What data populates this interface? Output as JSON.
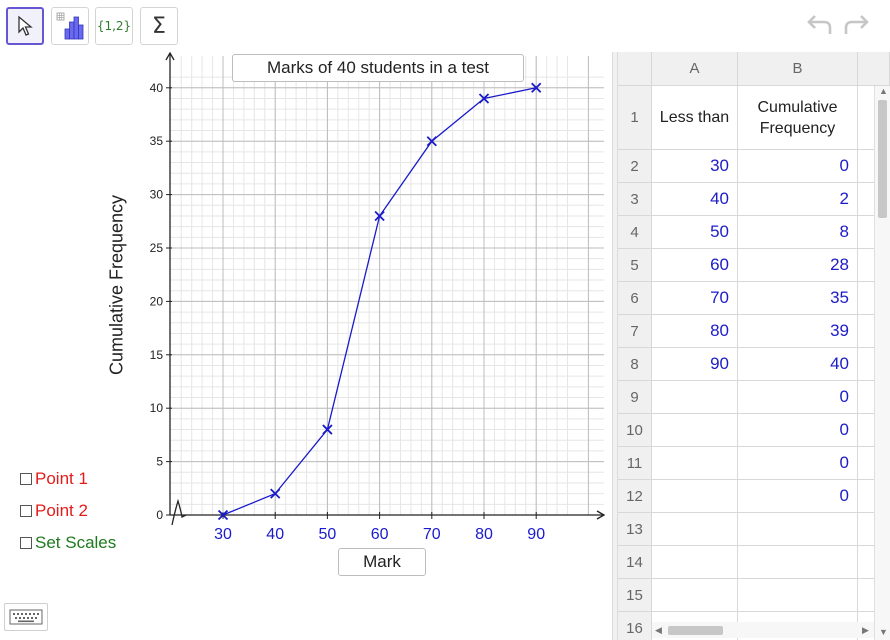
{
  "toolbar": {
    "tools": [
      {
        "name": "move-tool",
        "icon": "cursor-arrow-icon",
        "active": true
      },
      {
        "name": "histogram-tool",
        "icon": "bar-chart-icon",
        "active": false
      },
      {
        "name": "create-list-tool",
        "label": "{1,2}",
        "active": false
      },
      {
        "name": "sum-tool",
        "label": "Σ",
        "active": false
      }
    ],
    "undo_icon": "undo-arrow-icon",
    "redo_icon": "redo-arrow-icon"
  },
  "graph": {
    "title": "Marks of 40 students in a test",
    "xlabel": "Mark",
    "ylabel": "Cumulative Frequency"
  },
  "checkboxes": [
    {
      "label": "Point 1",
      "color": "#e31b1b",
      "checked": false
    },
    {
      "label": "Point 2",
      "color": "#e31b1b",
      "checked": false
    },
    {
      "label": "Set Scales",
      "color": "#1e7a1e",
      "checked": false
    }
  ],
  "keyboard_icon": "keyboard-icon",
  "chart_data": {
    "type": "line",
    "title": "Marks of 40 students in a test",
    "xlabel": "Mark",
    "ylabel": "Cumulative Frequency",
    "x": [
      30,
      40,
      50,
      60,
      70,
      80,
      90
    ],
    "series": [
      {
        "values": [
          0,
          2,
          8,
          28,
          35,
          39,
          40
        ]
      }
    ],
    "xticks": [
      30,
      40,
      50,
      60,
      70,
      80,
      90
    ],
    "yticks": [
      0,
      5,
      10,
      15,
      20,
      25,
      30,
      35,
      40
    ],
    "xlim": [
      20,
      96
    ],
    "ylim": [
      0,
      41
    ],
    "grid": true,
    "axis_break_x": true,
    "marker": "x",
    "color": "#1a1acc"
  },
  "spreadsheet": {
    "columns": [
      "A",
      "B"
    ],
    "rows": [
      {
        "num": "1",
        "a": "Less than",
        "b": "Cumulative Frequency",
        "header": true
      },
      {
        "num": "2",
        "a": "30",
        "b": "0"
      },
      {
        "num": "3",
        "a": "40",
        "b": "2"
      },
      {
        "num": "4",
        "a": "50",
        "b": "8"
      },
      {
        "num": "5",
        "a": "60",
        "b": "28"
      },
      {
        "num": "6",
        "a": "70",
        "b": "35"
      },
      {
        "num": "7",
        "a": "80",
        "b": "39"
      },
      {
        "num": "8",
        "a": "90",
        "b": "40"
      },
      {
        "num": "9",
        "a": "",
        "b": "0"
      },
      {
        "num": "10",
        "a": "",
        "b": "0"
      },
      {
        "num": "11",
        "a": "",
        "b": "0"
      },
      {
        "num": "12",
        "a": "",
        "b": "0"
      },
      {
        "num": "13",
        "a": "",
        "b": ""
      },
      {
        "num": "14",
        "a": "",
        "b": ""
      },
      {
        "num": "15",
        "a": "",
        "b": ""
      },
      {
        "num": "16",
        "a": "",
        "b": ""
      }
    ]
  }
}
